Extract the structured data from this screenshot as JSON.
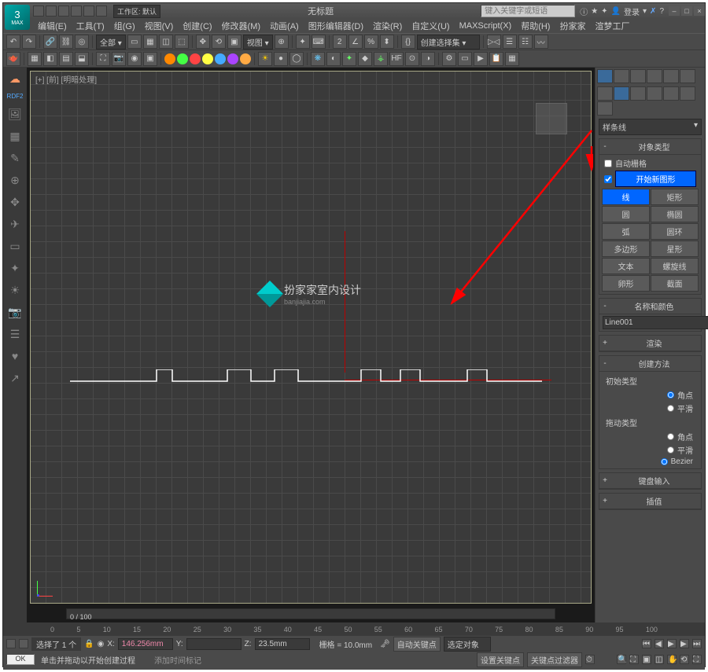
{
  "title": "无标题",
  "workspace_label": "工作区: 默认",
  "search_placeholder": "键入关键字或短语",
  "login_label": "登录",
  "menubar": [
    "编辑(E)",
    "工具(T)",
    "组(G)",
    "视图(V)",
    "创建(C)",
    "修改器(M)",
    "动画(A)",
    "图形编辑器(D)",
    "渲染(R)",
    "自定义(U)",
    "MAXScript(X)",
    "帮助(H)",
    "扮家家",
    "渲梦工厂"
  ],
  "toolbar": {
    "all_dropdown": "全部",
    "view_dropdown": "视图",
    "create_set": "创建选择集"
  },
  "left_label": "RDF2",
  "viewport": {
    "label": "[+] [前] [明暗处理]",
    "logo_text": "扮家家室内设计",
    "logo_sub": "banjiajia.com",
    "slider_value": "0 / 100"
  },
  "right": {
    "shape_dropdown": "样条线",
    "object_type_header": "对象类型",
    "auto_grid_label": "自动栅格",
    "start_new_shape": "开始新图形",
    "buttons": [
      {
        "l": "线",
        "sel": true
      },
      {
        "l": "矩形"
      },
      {
        "l": "圆"
      },
      {
        "l": "椭圆"
      },
      {
        "l": "弧"
      },
      {
        "l": "圆环"
      },
      {
        "l": "多边形"
      },
      {
        "l": "星形"
      },
      {
        "l": "文本"
      },
      {
        "l": "螺旋线"
      },
      {
        "l": "卵形"
      },
      {
        "l": "截面"
      }
    ],
    "name_color_header": "名称和颜色",
    "object_name": "Line001",
    "render_header": "渲染",
    "create_method_header": "创建方法",
    "initial_type_label": "初始类型",
    "drag_type_label": "拖动类型",
    "radio_corner": "角点",
    "radio_smooth": "平滑",
    "radio_bezier": "Bezier",
    "keyboard_header": "键盘输入",
    "interp_header": "插值"
  },
  "timeline": {
    "ticks": [
      "0",
      "5",
      "10",
      "15",
      "20",
      "25",
      "30",
      "35",
      "40",
      "45",
      "50",
      "55",
      "60",
      "65",
      "70",
      "75",
      "80",
      "85",
      "90",
      "95",
      "100"
    ],
    "selected_label": "选择了 1 个",
    "x_label": "X:",
    "x_val": "146.256mm",
    "y_label": "Y:",
    "y_val": "",
    "z_label": "Z:",
    "z_val": "23.5mm",
    "grid_label": "栅格 = 10.0mm",
    "autokey_label": "自动关键点",
    "selected_obj": "选定对象",
    "setkey_label": "设置关键点",
    "keyfilter_label": "关键点过滤器",
    "add_time_tag": "添加时间标记"
  },
  "status": {
    "ok": "OK",
    "hint": "单击并拖动以开始创建过程"
  }
}
